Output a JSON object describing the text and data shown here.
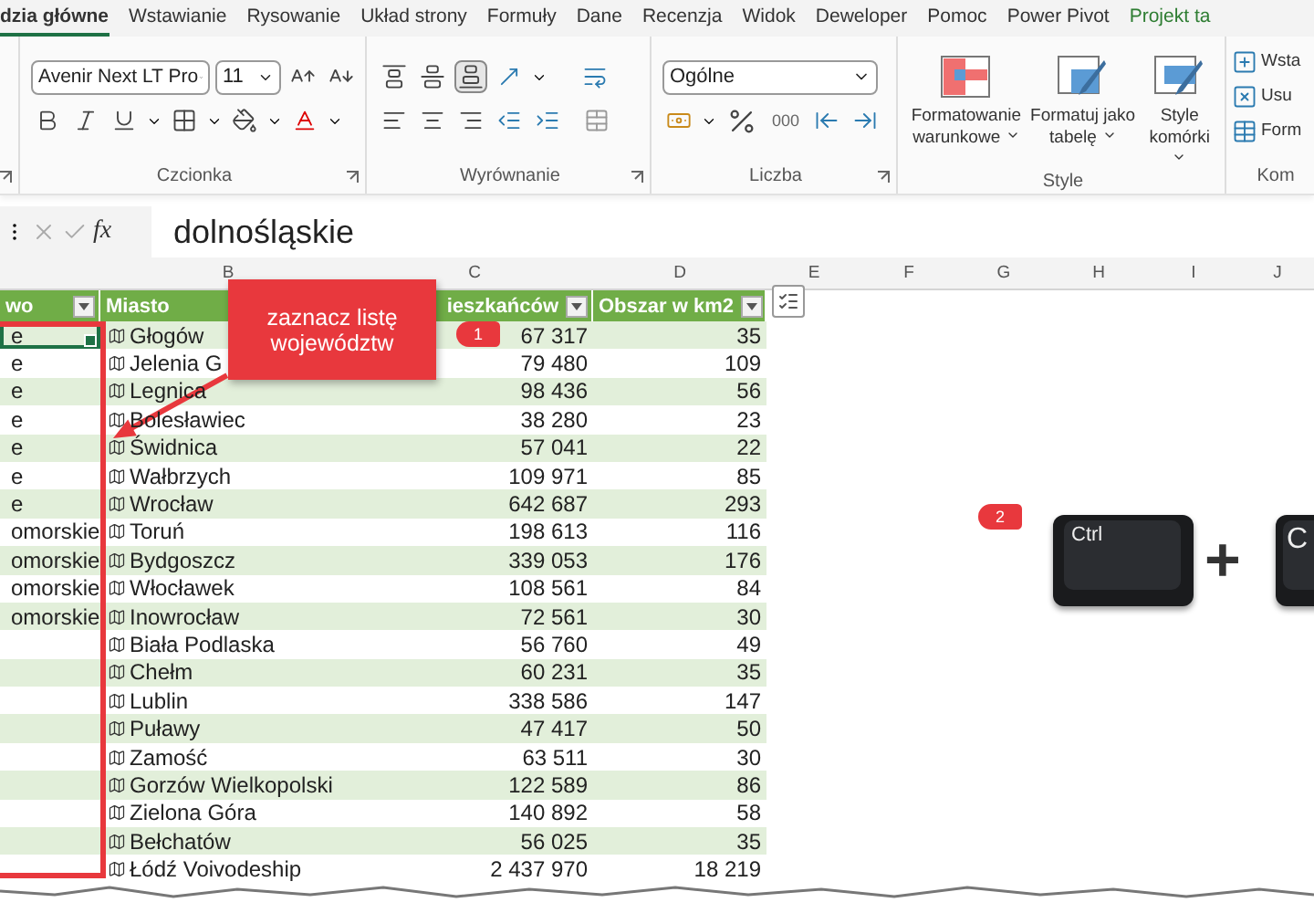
{
  "ribbon_tabs": [
    {
      "label": "dzia główne",
      "selected": true
    },
    {
      "label": "Wstawianie",
      "selected": false
    },
    {
      "label": "Rysowanie",
      "selected": false
    },
    {
      "label": "Układ strony",
      "selected": false
    },
    {
      "label": "Formuły",
      "selected": false
    },
    {
      "label": "Dane",
      "selected": false
    },
    {
      "label": "Recenzja",
      "selected": false
    },
    {
      "label": "Widok",
      "selected": false
    },
    {
      "label": "Deweloper",
      "selected": false
    },
    {
      "label": "Pomoc",
      "selected": false
    },
    {
      "label": "Power Pivot",
      "selected": false
    },
    {
      "label": "Projekt ta",
      "selected": false,
      "kind": "contextual"
    }
  ],
  "ribbon": {
    "font": {
      "name": "Avenir Next LT Pro",
      "size": "11",
      "label": "Czcionka"
    },
    "alignment": {
      "label": "Wyrównanie",
      "vertical": [
        {
          "selected": false
        },
        {
          "selected": false
        },
        {
          "selected": true
        }
      ]
    },
    "number": {
      "format": "Ogólne",
      "thousands": "000",
      "label": "Liczba"
    },
    "styles": {
      "label": "Style",
      "buttons": [
        "Formatowanie warunkowe",
        "Formatuj jako tabelę",
        "Style komórki"
      ]
    },
    "cells": {
      "label": "Kom",
      "buttons": [
        "Wsta",
        "Usu",
        "Form"
      ]
    }
  },
  "formula_bar": {
    "function_label": "fx",
    "value": "dolnośląskie"
  },
  "column_letters": [
    "B",
    "C",
    "D",
    "E",
    "F",
    "G",
    "H",
    "I",
    "J"
  ],
  "table": {
    "columns": [
      {
        "label": "wo",
        "filter": true
      },
      {
        "label": "Miasto",
        "filter": false
      },
      {
        "label": "ieszkańców",
        "filter": true
      },
      {
        "label": "Obszar w km2",
        "filter": true
      }
    ],
    "rows": [
      {
        "column_1": "e",
        "miasto": "Głogów",
        "column_3": "67 317",
        "obszar": "35",
        "active": true
      },
      {
        "column_1": "e",
        "miasto": "Jelenia G",
        "column_3": "79 480",
        "obszar": "109",
        "active": false
      },
      {
        "column_1": "e",
        "miasto": "Legnica",
        "column_3": "98 436",
        "obszar": "56",
        "active": false
      },
      {
        "column_1": "e",
        "miasto": "Bolesławiec",
        "column_3": "38 280",
        "obszar": "23",
        "active": false
      },
      {
        "column_1": "e",
        "miasto": "Świdnica",
        "column_3": "57 041",
        "obszar": "22",
        "active": false
      },
      {
        "column_1": "e",
        "miasto": "Wałbrzych",
        "column_3": "109 971",
        "obszar": "85",
        "active": false
      },
      {
        "column_1": "e",
        "miasto": "Wrocław",
        "column_3": "642 687",
        "obszar": "293",
        "active": false
      },
      {
        "column_1": "omorskie",
        "miasto": "Toruń",
        "column_3": "198 613",
        "obszar": "116",
        "active": false
      },
      {
        "column_1": "omorskie",
        "miasto": "Bydgoszcz",
        "column_3": "339 053",
        "obszar": "176",
        "active": false
      },
      {
        "column_1": "omorskie",
        "miasto": "Włocławek",
        "column_3": "108 561",
        "obszar": "84",
        "active": false
      },
      {
        "column_1": "omorskie",
        "miasto": "Inowrocław",
        "column_3": "72 561",
        "obszar": "30",
        "active": false
      },
      {
        "miasto": "Biała Podlaska",
        "column_3": "56 760",
        "obszar": "49",
        "active": false
      },
      {
        "miasto": "Chełm",
        "column_3": "60 231",
        "obszar": "35",
        "active": false
      },
      {
        "miasto": "Lublin",
        "column_3": "338 586",
        "obszar": "147",
        "active": false
      },
      {
        "miasto": "Puławy",
        "column_3": "47 417",
        "obszar": "50",
        "active": false
      },
      {
        "miasto": "Zamość",
        "column_3": "63 511",
        "obszar": "30",
        "active": false
      },
      {
        "miasto": "Gorzów Wielkopolski",
        "column_3": "122 589",
        "obszar": "86",
        "active": false
      },
      {
        "miasto": "Zielona Góra",
        "column_3": "140 892",
        "obszar": "58",
        "active": false
      },
      {
        "miasto": "Bełchatów",
        "column_3": "56 025",
        "obszar": "35",
        "active": false
      },
      {
        "miasto": "Łódź Voivodeship",
        "column_3": "2 437 970",
        "obszar": "18 219",
        "active": false
      }
    ]
  },
  "annotations": {
    "callout": "zaznacz listę województw",
    "step_1": "1",
    "step_2": "2",
    "keys": [
      "Ctrl",
      "C"
    ],
    "plus": "+"
  }
}
